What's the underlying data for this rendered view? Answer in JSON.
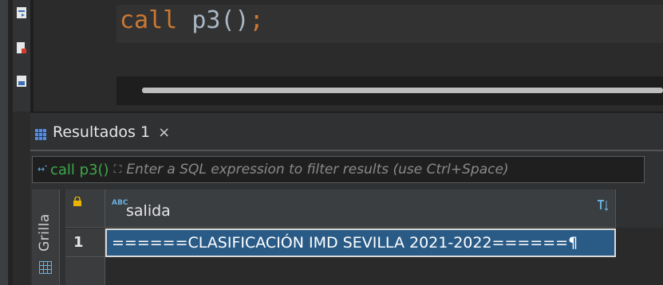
{
  "editor": {
    "code_keyword": "call",
    "code_function": "p3()",
    "code_semicolon": ";"
  },
  "gutter": {
    "icons": [
      "execute-statement-icon",
      "execute-script-icon",
      "explain-plan-icon"
    ]
  },
  "results": {
    "tab_label": "Resultados 1",
    "tab_close": "×",
    "filter_prefix": "call p3()",
    "filter_placeholder": "Enter a SQL expression to filter results (use Ctrl+Space)",
    "side_tab_label": "Grilla",
    "columns": [
      {
        "type_badge": "ABC",
        "name": "salida"
      }
    ],
    "rows": [
      {
        "num": "1",
        "salida": "======CLASIFICACIÓN IMD SEVILLA 2021-2022======¶"
      }
    ]
  },
  "colors": {
    "keyword": "#cc7832",
    "text": "#a9b7c6",
    "filter_prefix": "#3ea84a",
    "selected_cell": "#2a5b87"
  }
}
